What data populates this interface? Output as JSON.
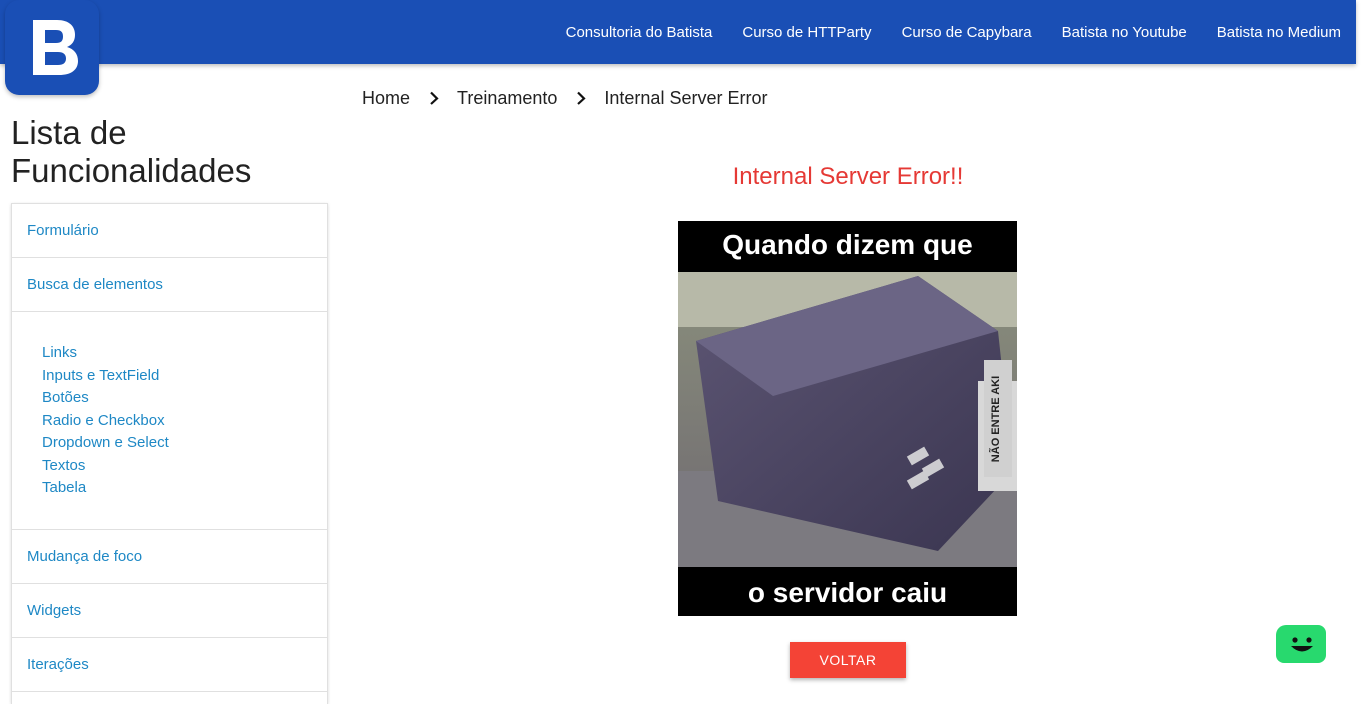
{
  "header": {
    "logo_letter": "B",
    "nav": [
      {
        "label": "Consultoria do Batista"
      },
      {
        "label": "Curso de HTTParty"
      },
      {
        "label": "Curso de Capybara"
      },
      {
        "label": "Batista no Youtube"
      },
      {
        "label": "Batista no Medium"
      }
    ]
  },
  "breadcrumb": {
    "items": [
      "Home",
      "Treinamento",
      "Internal Server Error"
    ]
  },
  "sidebar": {
    "title": "Lista de Funcionalidades",
    "items": {
      "formulario": "Formulário",
      "busca": "Busca de elementos",
      "sub": [
        "Links",
        "Inputs e TextField",
        "Botões",
        "Radio e Checkbox",
        "Dropdown e Select",
        "Textos",
        "Tabela"
      ],
      "foco": "Mudança de foco",
      "widgets": "Widgets",
      "iteracoes": "Iterações"
    }
  },
  "main": {
    "title": "Internal Server Error!!",
    "meme_top": "Quando dizem que",
    "meme_bottom": "o servidor caiu",
    "meme_sticker": "NÃO ENTRE AKI",
    "voltar_label": "VOLTAR"
  },
  "colors": {
    "header_blue": "#1a4fb5",
    "link_blue": "#1e88c5",
    "error_red": "#e53935",
    "button_red": "#f44336",
    "chat_green": "#28d96e"
  }
}
